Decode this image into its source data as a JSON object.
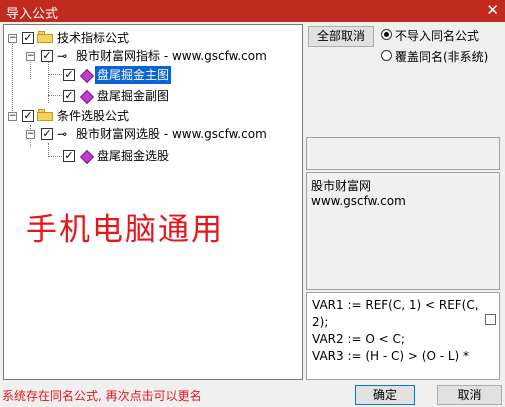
{
  "window": {
    "title": "导入公式",
    "close_glyph": "✕"
  },
  "tree": {
    "nodes": [
      {
        "label": "技术指标公式"
      },
      {
        "label": "股市财富网指标 - www.gscfw.com"
      },
      {
        "label": "盘尾掘金主图"
      },
      {
        "label": "盘尾掘金副图"
      },
      {
        "label": "条件选股公式"
      },
      {
        "label": "股市财富网选股 - www.gscfw.com"
      },
      {
        "label": "盘尾掘金选股"
      }
    ],
    "expander_glyph": "−",
    "check_glyph": "✓"
  },
  "watermark": "手机电脑通用",
  "buttons": {
    "deselect_all": "全部取消",
    "ok": "确定",
    "cancel": "取消"
  },
  "options": {
    "no_import_same_name": "不导入同名公式",
    "overwrite_same_name": "覆盖同名(非系统)",
    "selected": "no_import_same_name"
  },
  "description": {
    "lines": [
      "股市财富网",
      "www.gscfw.com"
    ]
  },
  "code": {
    "lines": [
      "VAR1 := REF(C, 1) < REF(C,",
      "2);",
      "VAR2 := O < C;",
      "VAR3 := (H - C) > (O - L) *"
    ]
  },
  "status_text": "系统存在同名公式, 再次点击可以更名",
  "colors": {
    "titlebar": "#c12a1f",
    "selection": "#0a64d6",
    "watermark": "#e8151b",
    "status": "#e8151b"
  }
}
